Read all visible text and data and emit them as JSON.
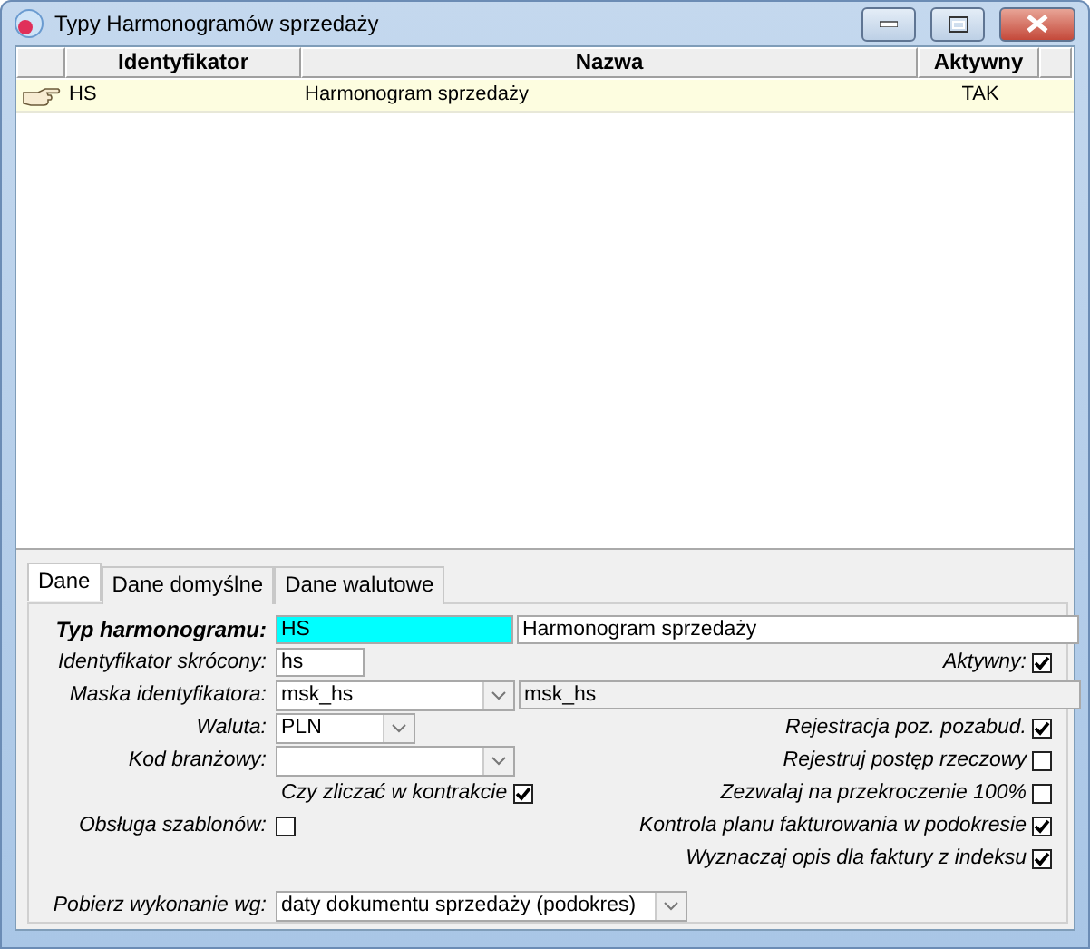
{
  "window": {
    "title": "Typy Harmonogramów sprzedaży"
  },
  "table": {
    "columns": [
      "Identyfikator",
      "Nazwa",
      "Aktywny"
    ],
    "rows": [
      {
        "cells": [
          "HS",
          "Harmonogram sprzedaży",
          "TAK"
        ],
        "selected": true
      }
    ]
  },
  "tabs": [
    {
      "label": "Dane",
      "selected": true
    },
    {
      "label": "Dane domyślne",
      "selected": false
    },
    {
      "label": "Dane walutowe",
      "selected": false
    }
  ],
  "form": {
    "type_field": {
      "label": "Typ harmonogramu:",
      "code": "HS",
      "name": "Harmonogram sprzedaży"
    },
    "short_id": {
      "label": "Identyfikator skrócony:",
      "value": "hs"
    },
    "mask": {
      "label": "Maska identyfikatora:",
      "value": "msk_hs",
      "description": "msk_hs"
    },
    "currency": {
      "label": "Waluta:",
      "value": "PLN"
    },
    "industry_code": {
      "label": "Kod branżowy:"
    },
    "count_in_contract": {
      "label": "Czy zliczać w kontrakcie",
      "checked": true
    },
    "templates": {
      "label": "Obsługa szablonów:",
      "checked": false
    },
    "fetch_by": {
      "label": "Pobierz wykonanie wg:",
      "value": "daty dokumentu sprzedaży (podokres)"
    },
    "flags": [
      {
        "label": "Aktywny:",
        "checked": true
      },
      {
        "label": "Rejestracja poz. pozabud.",
        "checked": true
      },
      {
        "label": "Rejestruj postęp rzeczowy",
        "checked": false
      },
      {
        "label": "Zezwalaj na przekroczenie 100%",
        "checked": false
      },
      {
        "label": "Kontrola planu fakturowania w podokresie",
        "checked": true
      },
      {
        "label": "Wyznaczaj opis dla faktury z indeksu",
        "checked": true
      }
    ]
  }
}
